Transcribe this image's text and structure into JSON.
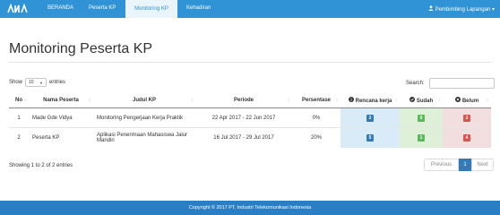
{
  "nav": {
    "logo_icon": "brand-logo-icon",
    "items": [
      {
        "label": "BERANDA"
      },
      {
        "label": "Peserta KP"
      },
      {
        "label": "Monitoring KP",
        "active": true
      },
      {
        "label": "Kehadiran"
      }
    ],
    "user_icon": "user-icon",
    "user_label": "Pembimbing Lapangan",
    "caret": "▾"
  },
  "page": {
    "title": "Monitoring Peserta KP"
  },
  "controls": {
    "show_label": "Show",
    "entries_value": "10",
    "entries_label": "entries",
    "search_label": "Search:",
    "search_value": ""
  },
  "table": {
    "headers": [
      {
        "label": "No",
        "icon": ""
      },
      {
        "label": "Nama Peserta",
        "icon": ""
      },
      {
        "label": "Judul KP",
        "icon": ""
      },
      {
        "label": "Periode",
        "icon": ""
      },
      {
        "label": "Persentase",
        "icon": ""
      },
      {
        "label": "Rencana kerja",
        "icon": "info-circle-icon"
      },
      {
        "label": "Sudah",
        "icon": "check-circle-icon"
      },
      {
        "label": "Belum",
        "icon": "x-circle-icon"
      }
    ],
    "rows": [
      {
        "no": "1",
        "nama": "Made Gde Vidya",
        "judul": "Monitoring Pengerjaan Kerja Praktik",
        "periode": "22 Apr 2017 - 22 Jun 2017",
        "persentase": "0%",
        "rencana": "2",
        "sudah": "0",
        "belum": "2"
      },
      {
        "no": "2",
        "nama": "Peserta KP",
        "judul": "Aplikasi Penerimaan Mahasiswa Jalur Mandiri",
        "periode": "16 Jul 2017 - 29 Jul 2017",
        "persentase": "20%",
        "rencana": "5",
        "sudah": "1",
        "belum": "4"
      }
    ]
  },
  "pagination": {
    "info": "Showing 1 to 2 of 2 entries",
    "previous": "Previous",
    "current": "1",
    "next": "Next"
  },
  "footer": {
    "text": "Copyright © 2017 PT. Industri Telekomunikasi Indonesia"
  },
  "colors": {
    "primary": "#2f93d6",
    "footer": "#2a7fc4",
    "rencana_bg": "#d9ebf7",
    "sudah_bg": "#dff0d8",
    "belum_bg": "#f2dede"
  }
}
